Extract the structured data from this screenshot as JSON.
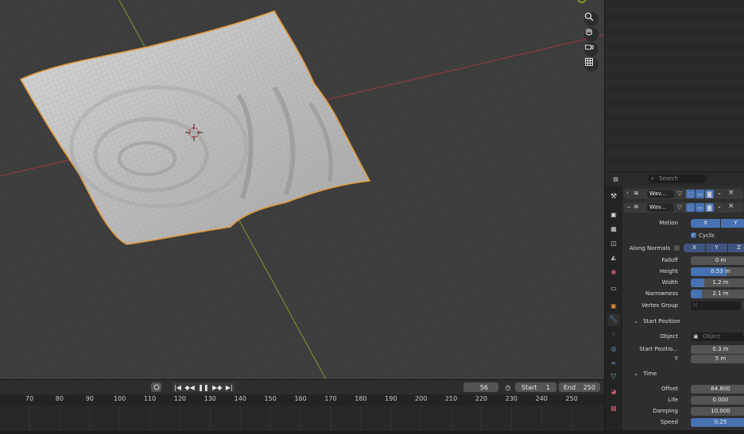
{
  "timeline": {
    "current_frame": "56",
    "start_label": "Start",
    "start_value": "1",
    "end_label": "End",
    "end_value": "250",
    "ruler": [
      "70",
      "80",
      "90",
      "100",
      "110",
      "120",
      "130",
      "140",
      "150",
      "160",
      "170",
      "180",
      "190",
      "200",
      "210",
      "220",
      "230",
      "240",
      "250"
    ]
  },
  "properties": {
    "search_placeholder": "Search",
    "modifiers": [
      {
        "name": "Wav..."
      },
      {
        "name": "Wav..."
      }
    ],
    "motion_label": "Motion",
    "motion_x": "X",
    "motion_y": "Y",
    "cyclic_label": "Cyclic",
    "along_normals_label": "Along Normals",
    "along_x": "X",
    "along_y": "Y",
    "along_z": "Z",
    "falloff": {
      "label": "Falloff",
      "value": "0 m"
    },
    "height": {
      "label": "Height",
      "value": "0.53 m",
      "fill": 0.6
    },
    "width": {
      "label": "Width",
      "value": "1.2 m",
      "fill": 0.22
    },
    "narrowness": {
      "label": "Narrowness",
      "value": "2.1 m",
      "fill": 0.18
    },
    "vertex_group_label": "Vertex Group",
    "start_position_section": "Start Position",
    "object_label": "Object",
    "object_placeholder": "Object",
    "start_x": {
      "label": "Start Positio...",
      "value": "0.3 m"
    },
    "start_y": {
      "label": "Y",
      "value": "5 m"
    },
    "time_section": "Time",
    "offset": {
      "label": "Offset",
      "value": "64.800"
    },
    "life": {
      "label": "Life",
      "value": "0.000"
    },
    "damping": {
      "label": "Damping",
      "value": "10.000"
    },
    "speed": {
      "label": "Speed",
      "value": "0.25",
      "fill": 1.0
    }
  },
  "colors": {
    "accent": "#4772b3",
    "selection_outline": "#e69a3a",
    "x_axis": "#a3383f",
    "y_axis": "#7b9a2d"
  }
}
